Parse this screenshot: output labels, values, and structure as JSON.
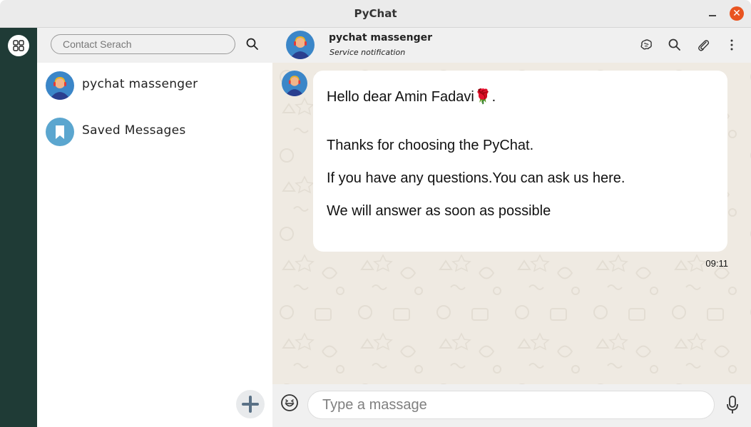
{
  "window": {
    "title": "PyChat",
    "close_glyph": "✕"
  },
  "rail": {
    "apps_icon": "apps-grid-icon"
  },
  "contacts": {
    "search_placeholder": "Contact Serach",
    "items": [
      {
        "name": "pychat massenger",
        "icon": "support-agent-avatar"
      },
      {
        "name": "Saved Messages",
        "icon": "bookmark-icon"
      }
    ]
  },
  "chat": {
    "name": "pychat massenger",
    "subtitle": "Service notification",
    "header_icons": [
      "brain-icon",
      "search-icon",
      "paperclip-icon",
      "more-vertical-icon"
    ],
    "messages": [
      {
        "lines": [
          "Hello dear Amin Fadavi🌹.",
          "Thanks for choosing the PyChat.",
          "If you have any questions.You can ask us here.",
          "We will answer as soon as possible"
        ],
        "time": "09:11"
      }
    ]
  },
  "composer": {
    "placeholder": "Type a massage"
  },
  "colors": {
    "rail": "#1f3b36",
    "chat_bg": "#efeae2",
    "accent_close": "#e95420",
    "avatar_bg": "#3b86c8"
  }
}
